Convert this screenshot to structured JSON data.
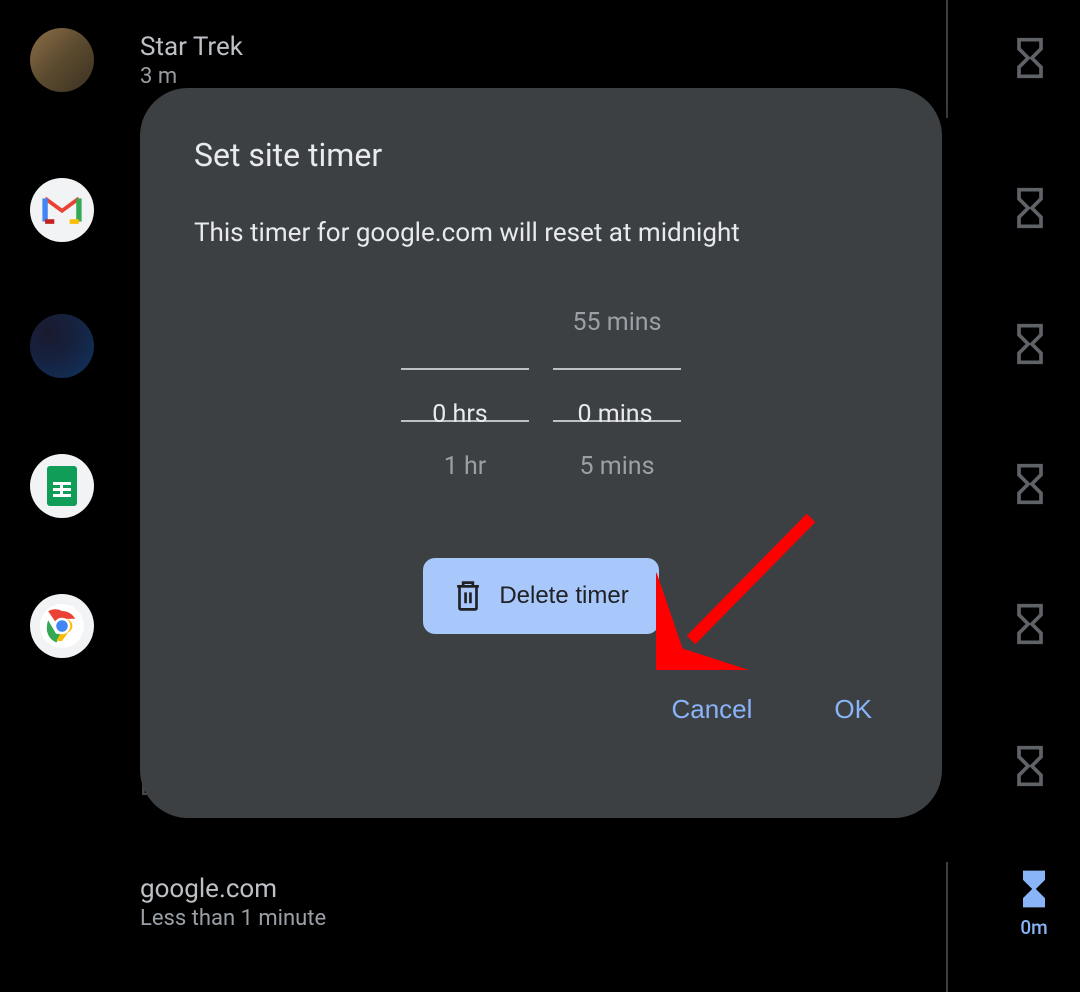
{
  "sites": [
    {
      "title": "Star Trek",
      "subtitle": "3 m"
    },
    {
      "title": "",
      "subtitle": ""
    },
    {
      "title": "",
      "subtitle": ""
    },
    {
      "title": "",
      "subtitle": ""
    },
    {
      "title": "",
      "subtitle": ""
    },
    {
      "title": "",
      "subtitle": ""
    },
    {
      "title": "google.com",
      "subtitle": "Less than 1 minute",
      "timer": "0m"
    }
  ],
  "dialog": {
    "title": "Set site timer",
    "subtitle": "This timer for google.com will reset at midnight",
    "picker": {
      "hours_above": "",
      "hours_selected": "0 hrs",
      "hours_below": "1 hr",
      "mins_above": "55 mins",
      "mins_selected": "0 mins",
      "mins_below": "5 mins"
    },
    "delete_label": "Delete timer",
    "cancel_label": "Cancel",
    "ok_label": "OK"
  }
}
